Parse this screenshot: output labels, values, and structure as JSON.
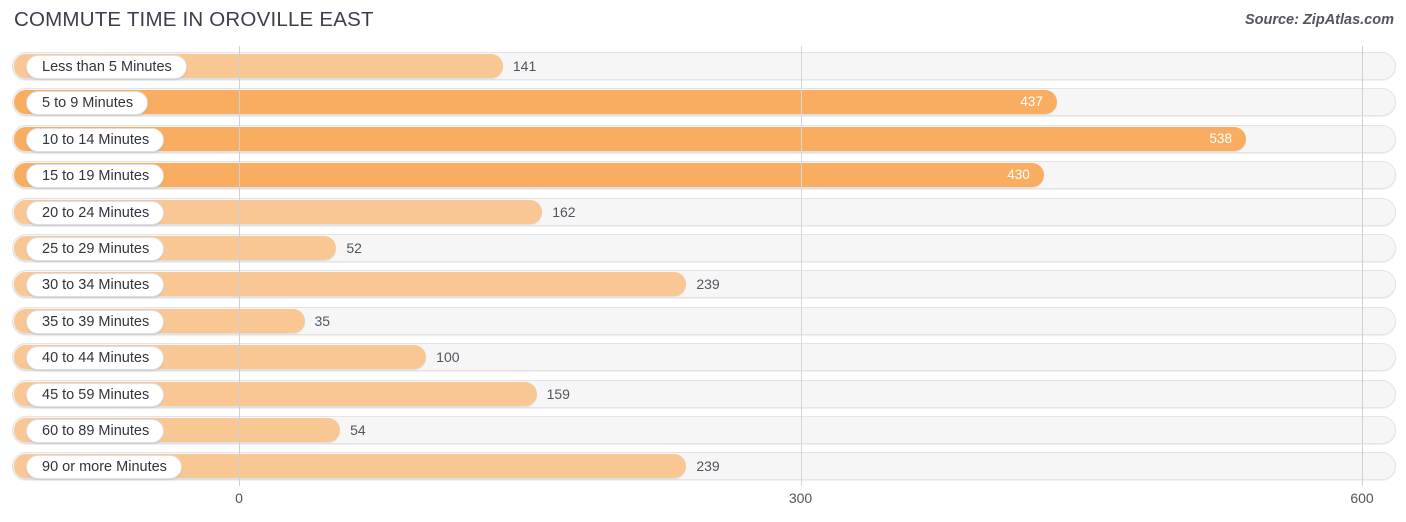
{
  "header": {
    "title": "COMMUTE TIME IN OROVILLE EAST",
    "source": "Source: ZipAtlas.com"
  },
  "chart_data": {
    "type": "bar",
    "orientation": "horizontal",
    "title": "COMMUTE TIME IN OROVILLE EAST",
    "xlabel": "",
    "ylabel": "",
    "xlim": [
      0,
      600
    ],
    "xticks": [
      0,
      300,
      600
    ],
    "xtick_labels": [
      "0",
      "300",
      "600"
    ],
    "grid": true,
    "legend": false,
    "categories": [
      "Less than 5 Minutes",
      "5 to 9 Minutes",
      "10 to 14 Minutes",
      "15 to 19 Minutes",
      "20 to 24 Minutes",
      "25 to 29 Minutes",
      "30 to 34 Minutes",
      "35 to 39 Minutes",
      "40 to 44 Minutes",
      "45 to 59 Minutes",
      "60 to 89 Minutes",
      "90 or more Minutes"
    ],
    "values": [
      141,
      437,
      538,
      430,
      162,
      52,
      239,
      35,
      100,
      159,
      54,
      239
    ],
    "value_labels": [
      "141",
      "437",
      "538",
      "430",
      "162",
      "52",
      "239",
      "35",
      "100",
      "159",
      "54",
      "239"
    ],
    "label_inside": [
      false,
      true,
      true,
      true,
      false,
      false,
      false,
      false,
      false,
      false,
      false,
      false
    ],
    "bar_colors": [
      "#f9c794",
      "#f9ad60",
      "#f9ad60",
      "#f9ad60",
      "#f9c794",
      "#f9c794",
      "#f9c794",
      "#f9c794",
      "#f9c794",
      "#f9c794",
      "#f9c794",
      "#f9c794"
    ],
    "colors": {
      "bar_light": "#f9c794",
      "bar_dark": "#f9ad60",
      "track": "#f6f6f6",
      "track_border": "#e3e3e6",
      "gridline": "#d6d6dc",
      "text": "#54545f",
      "title": "#3d3d4e"
    }
  }
}
